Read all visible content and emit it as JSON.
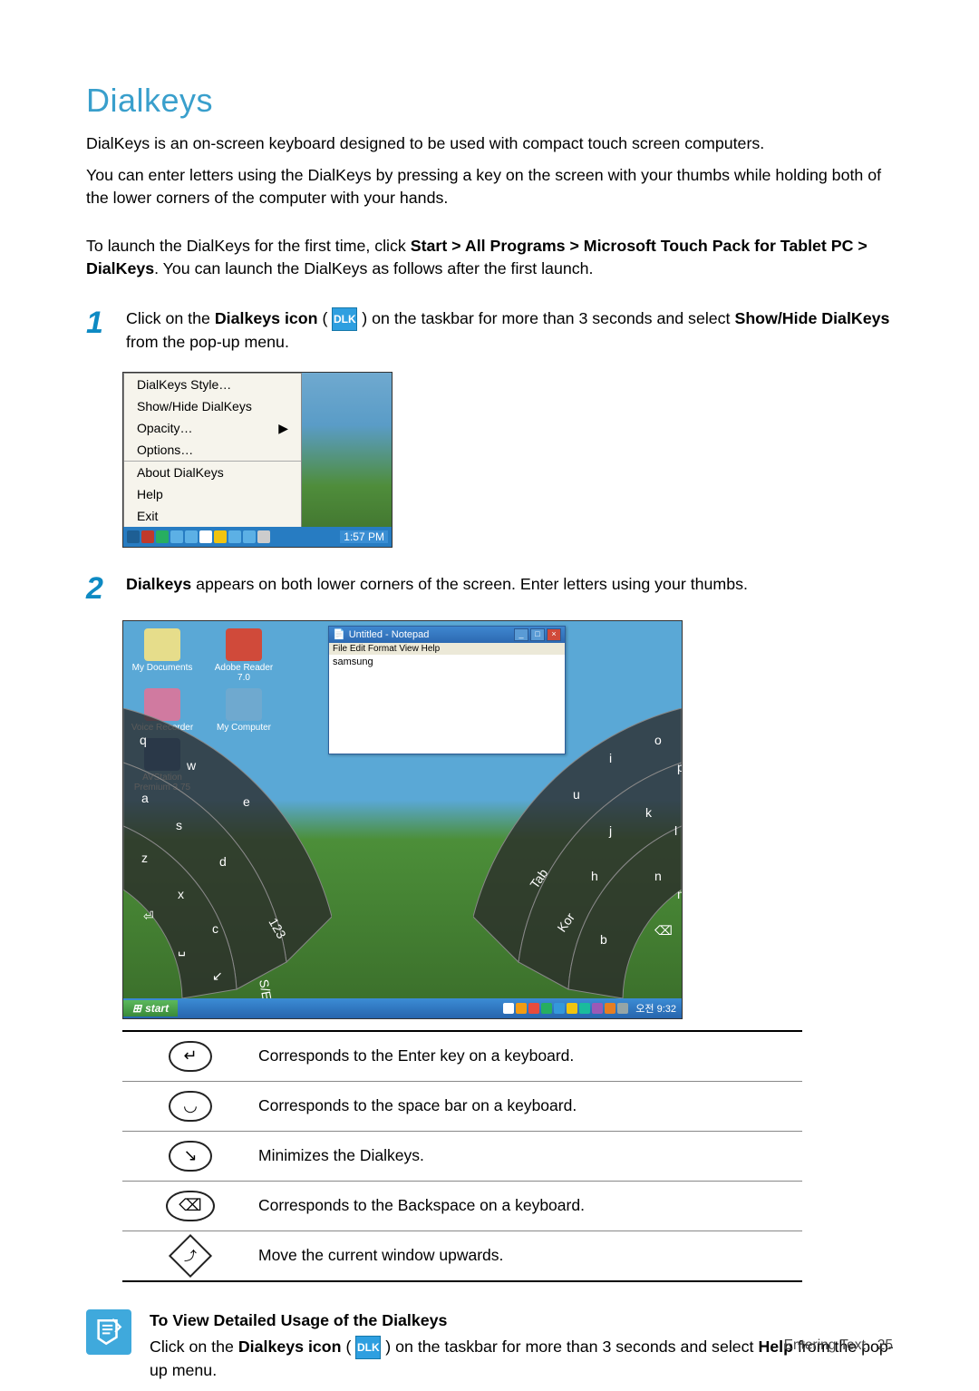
{
  "title": "Dialkeys",
  "intro1": "DialKeys is an on-screen keyboard designed to be used with compact touch screen computers.",
  "intro2": "You can enter letters using the DialKeys by pressing a key on the screen with your thumbs while holding both of the lower corners of the computer with your hands.",
  "launch_prefix": "To launch the DialKeys for the first time, click ",
  "launch_path": "Start > All Programs > Microsoft Touch Pack for Tablet PC > DialKeys",
  "launch_suffix": ". You can launch the DialKeys as follows after the first launch.",
  "step1_num": "1",
  "step1_a": "Click on the ",
  "step1_b": "Dialkeys icon",
  "step1_c": " ( ",
  "step1_icon": "DLK",
  "step1_d": " ) on the taskbar for more than 3 seconds and select ",
  "step1_e": "Show/Hide DialKeys",
  "step1_f": " from the pop-up menu.",
  "menu": {
    "items_top": [
      "DialKeys Style…",
      "Show/Hide DialKeys",
      "Opacity…",
      "Options…"
    ],
    "items_bottom": [
      "About DialKeys",
      "Help",
      "Exit"
    ],
    "submenu_arrow": "▶",
    "time": "1:57 PM"
  },
  "step2_num": "2",
  "step2_a": "Dialkeys",
  "step2_b": " appears on both lower corners of the screen. Enter letters using your thumbs.",
  "desktop": {
    "icons": [
      "My Documents",
      "Adobe Reader 7.0",
      "Voice Recorder",
      "My Computer",
      "AVStation Premium 3.75"
    ],
    "notepad_title": "Untitled - Notepad",
    "notepad_menu": "File   Edit   Format   View   Help",
    "notepad_text": "samsung",
    "start_label": "start",
    "tray_text": "오전 9:32",
    "left_keys": [
      "q",
      "w",
      "e",
      "a",
      "s",
      "d",
      "z",
      "x",
      "c",
      "⏎",
      "␣",
      "↙",
      "123",
      "S/E"
    ],
    "right_keys": [
      "o",
      "p",
      "i",
      "u",
      "k",
      "l",
      "j",
      "n",
      "m",
      "h",
      "Tab",
      "Kor",
      "b",
      "⌫"
    ]
  },
  "table": [
    {
      "sym": "enter",
      "desc": "Corresponds to the Enter key on a keyboard."
    },
    {
      "sym": "space",
      "desc": "Corresponds to the space bar on a keyboard."
    },
    {
      "sym": "minimize",
      "desc": "Minimizes the Dialkeys."
    },
    {
      "sym": "backspace",
      "desc": "Corresponds to the Backspace on a keyboard."
    },
    {
      "sym": "moveup",
      "desc": "Move the current window upwards."
    }
  ],
  "note_title": "To View Detailed Usage of the Dialkeys",
  "note_a": "Click on the ",
  "note_b": "Dialkeys icon",
  "note_c": " ( ",
  "note_icon": "DLK",
  "note_d": " ) on the taskbar for more than 3 seconds and select ",
  "note_e": "Help",
  "note_f": " from the pop-up menu.",
  "footer_text": "Entering Text",
  "footer_page": "25"
}
